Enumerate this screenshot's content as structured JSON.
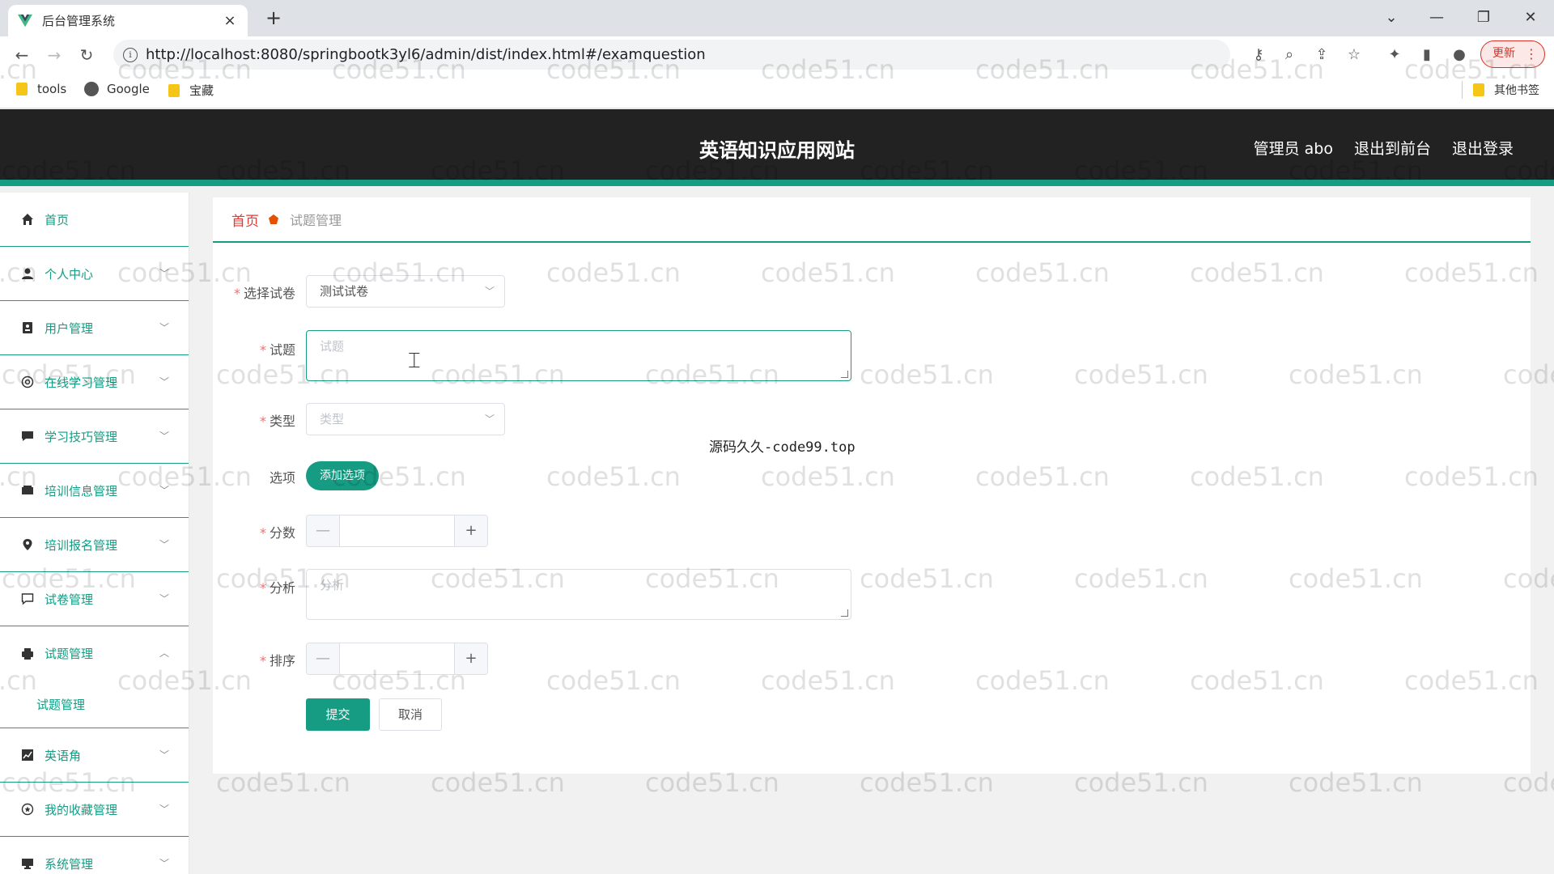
{
  "browser": {
    "tab_title": "后台管理系统",
    "tab_close": "×",
    "new_tab": "+",
    "url": "http://localhost:8080/springbootk3yl6/admin/dist/index.html#/examquestion",
    "update_label": "更新",
    "bookmarks": [
      "tools",
      "Google",
      "宝藏"
    ],
    "other_bookmarks": "其他书签"
  },
  "header": {
    "site_title": "英语知识应用网站",
    "admin_label": "管理员 abo",
    "exit_front": "退出到前台",
    "logout": "退出登录",
    "accent_color": "#159c83"
  },
  "sidebar": {
    "items": [
      {
        "label": "首页",
        "icon": "home-icon"
      },
      {
        "label": "个人中心",
        "icon": "user-icon"
      },
      {
        "label": "用户管理",
        "icon": "contact-card-icon"
      },
      {
        "label": "在线学习管理",
        "icon": "compass-icon"
      },
      {
        "label": "学习技巧管理",
        "icon": "chat-bubble-icon"
      },
      {
        "label": "培训信息管理",
        "icon": "ticket-icon"
      },
      {
        "label": "培训报名管理",
        "icon": "location-pin-icon"
      },
      {
        "label": "试卷管理",
        "icon": "comment-icon"
      },
      {
        "label": "试题管理",
        "icon": "printer-icon"
      },
      {
        "label": "英语角",
        "icon": "chart-icon"
      },
      {
        "label": "我的收藏管理",
        "icon": "star-circle-icon"
      },
      {
        "label": "系统管理",
        "icon": "monitor-icon"
      }
    ],
    "sub_item": "试题管理"
  },
  "breadcrumb": {
    "home": "首页",
    "current": "试题管理"
  },
  "form": {
    "paper_label": "选择试卷",
    "paper_value": "测试试卷",
    "question_label": "试题",
    "question_placeholder": "试题",
    "type_label": "类型",
    "type_placeholder": "类型",
    "options_label": "选项",
    "add_option": "添加选项",
    "score_label": "分数",
    "analysis_label": "分析",
    "analysis_placeholder": "分析",
    "sort_label": "排序",
    "submit": "提交",
    "cancel": "取消",
    "required_mark": "*"
  },
  "overlay_caption": "源码久久-code99.top",
  "watermark_text": "code51.cn"
}
